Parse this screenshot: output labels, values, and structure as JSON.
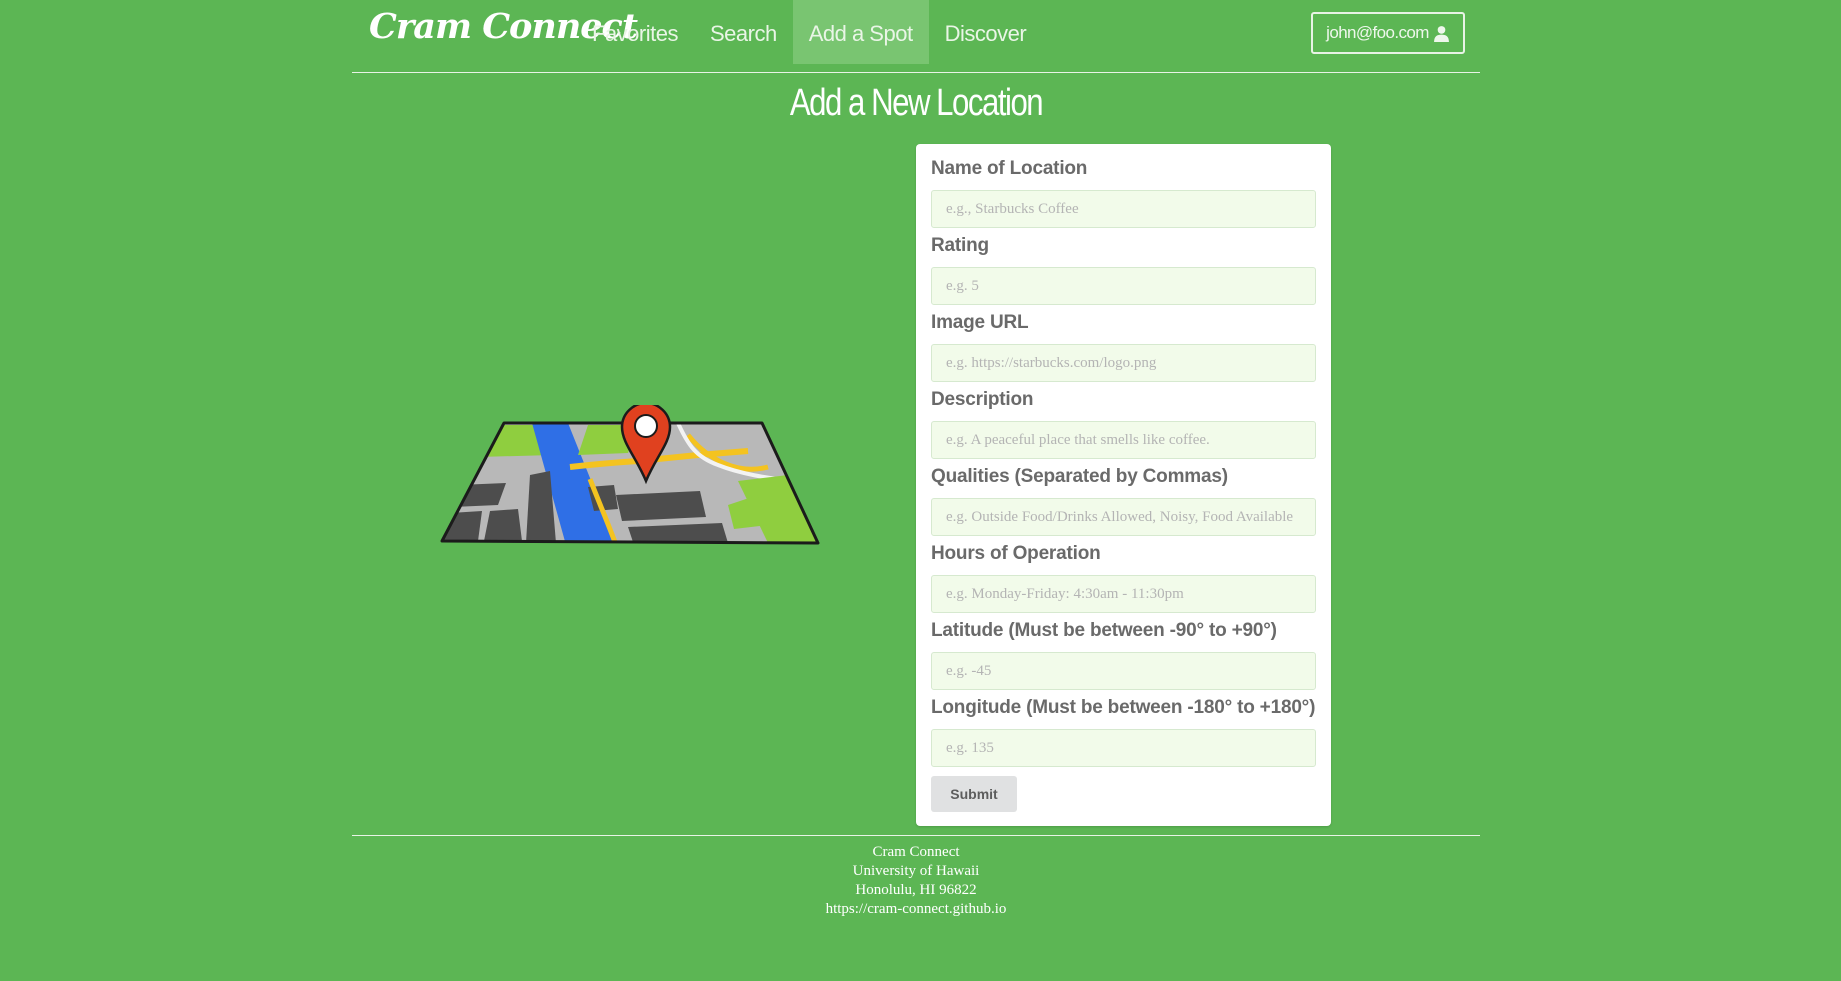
{
  "navbar": {
    "brand": "Cram Connect",
    "links": [
      {
        "label": "Favorites",
        "active": false
      },
      {
        "label": "Search",
        "active": false
      },
      {
        "label": "Add a Spot",
        "active": true
      },
      {
        "label": "Discover",
        "active": false
      }
    ],
    "user": {
      "email": "john@foo.com",
      "icon": "user-icon"
    }
  },
  "page": {
    "title": "Add a New Location"
  },
  "illustration": {
    "icon": "map-with-pin-illustration"
  },
  "form": {
    "fields": [
      {
        "label": "Name of Location",
        "placeholder": "e.g., Starbucks Coffee",
        "value": ""
      },
      {
        "label": "Rating",
        "placeholder": "e.g. 5",
        "value": ""
      },
      {
        "label": "Image URL",
        "placeholder": "e.g. https://starbucks.com/logo.png",
        "value": ""
      },
      {
        "label": "Description",
        "placeholder": "e.g. A peaceful place that smells like coffee.",
        "value": ""
      },
      {
        "label": "Qualities (Separated by Commas)",
        "placeholder": "e.g. Outside Food/Drinks Allowed, Noisy, Food Available",
        "value": ""
      },
      {
        "label": "Hours of Operation",
        "placeholder": "e.g. Monday-Friday: 4:30am - 11:30pm",
        "value": ""
      },
      {
        "label": "Latitude (Must be between -90° to +90°)",
        "placeholder": "e.g. -45",
        "value": ""
      },
      {
        "label": "Longitude (Must be between -180° to +180°)",
        "placeholder": "e.g. 135",
        "value": ""
      }
    ],
    "submit_label": "Submit"
  },
  "footer": {
    "line1": "Cram Connect",
    "line2": "University of Hawaii",
    "line3": "Honolulu, HI 96822",
    "line4": "https://cram-connect.github.io"
  },
  "colors": {
    "background": "#5cb654",
    "active_nav": "#79c571",
    "input_bg": "#f2fbea"
  }
}
